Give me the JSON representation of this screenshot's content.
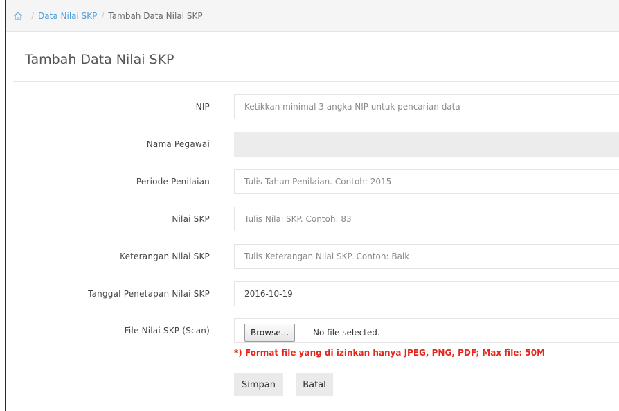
{
  "breadcrumb": {
    "home_icon": "home-icon",
    "separator": "/",
    "items": [
      {
        "label": "Data Nilai SKP"
      },
      {
        "label": "Tambah Data Nilai SKP"
      }
    ]
  },
  "panel": {
    "title": "Tambah Data Nilai SKP"
  },
  "form": {
    "nip": {
      "label": "NIP",
      "placeholder": "Ketikkan minimal 3 angka NIP untuk pencarian data",
      "value": ""
    },
    "nama": {
      "label": "Nama Pegawai",
      "value": ""
    },
    "periode": {
      "label": "Periode Penilaian",
      "placeholder": "Tulis Tahun Penilaian. Contoh: 2015",
      "value": ""
    },
    "nilai": {
      "label": "Nilai SKP",
      "placeholder": "Tulis Nilai SKP. Contoh: 83",
      "value": ""
    },
    "keterangan": {
      "label": "Keterangan Nilai SKP",
      "placeholder": "Tulis Keterangan Nilai SKP. Contoh: Baik",
      "value": ""
    },
    "tanggal": {
      "label": "Tanggal Penetapan Nilai SKP",
      "value": "2016-10-19"
    },
    "file": {
      "label": "File Nilai SKP (Scan)",
      "browse_label": "Browse...",
      "status": "No file selected.",
      "note": "*) Format file yang di izinkan hanya JPEG, PNG, PDF; Max file: 50M"
    }
  },
  "actions": {
    "save_label": "Simpan",
    "cancel_label": "Batal"
  },
  "colors": {
    "link": "#4a9fd8",
    "note": "#e5261b",
    "button_bg": "#eaeaea",
    "readonly_bg": "#ececec"
  }
}
